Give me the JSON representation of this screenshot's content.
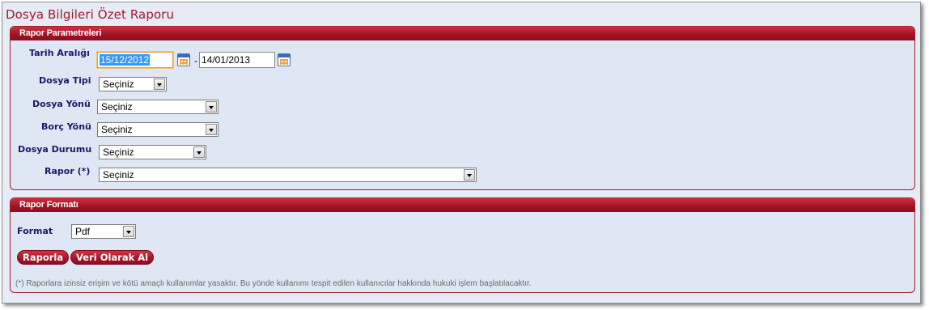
{
  "page": {
    "title": "Dosya Bilgileri Özet Raporu"
  },
  "parameters": {
    "header": "Rapor Parametreleri",
    "date_range": {
      "label": "Tarih Aralığı",
      "start": "15/12/2012",
      "separator": "-",
      "end": "14/01/2013"
    },
    "file_type": {
      "label": "Dosya Tipi",
      "value": "Seçiniz"
    },
    "file_direction": {
      "label": "Dosya Yönü",
      "value": "Seçiniz"
    },
    "debt_direction": {
      "label": "Borç Yönü",
      "value": "Seçiniz"
    },
    "file_status": {
      "label": "Dosya Durumu",
      "value": "Seçiniz"
    },
    "report": {
      "label": "Rapor (*)",
      "value": "Seçiniz"
    }
  },
  "format_panel": {
    "header": "Rapor Formatı",
    "format": {
      "label": "Format",
      "value": "Pdf"
    },
    "report_button": "Raporla",
    "data_button": "Veri Olarak Al",
    "note": "(*) Raporlara izinsiz erişim ve kötü amaçlı kullanımlar yasaktır. Bu yönde kullanımı tespit edilen kullanıcılar hakkında hukuki işlem başlatılacaktır."
  },
  "colors": {
    "accent": "#a0182b",
    "panel_bg": "#dfe7f4",
    "label": "#1a1a66"
  },
  "icons": [
    "calendar-icon",
    "chevron-down-icon"
  ]
}
